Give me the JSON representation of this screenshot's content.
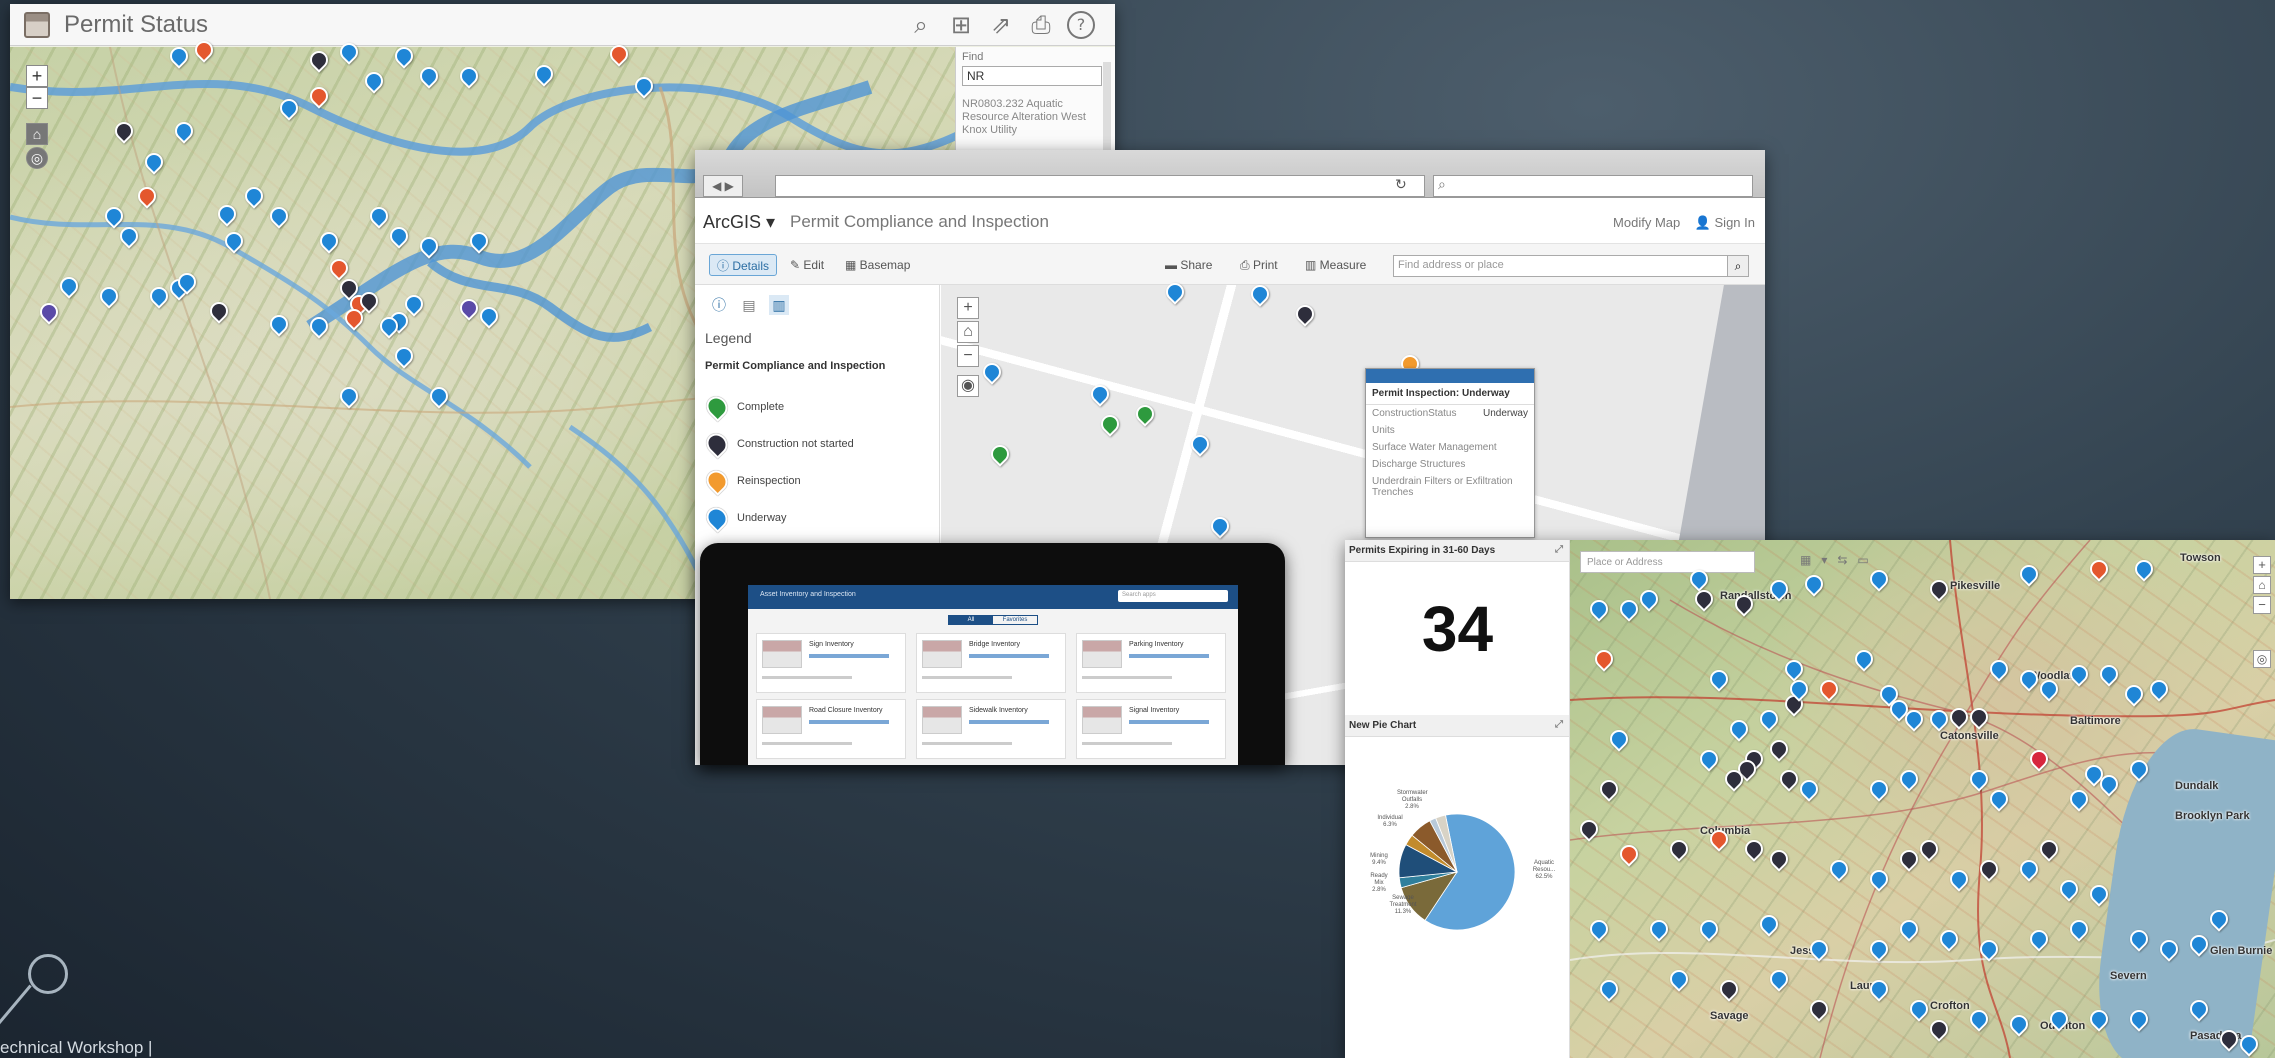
{
  "window1": {
    "title": "Permit Status",
    "tools": [
      {
        "name": "search-icon",
        "glyph": "⌕"
      },
      {
        "name": "basemap-gallery-icon",
        "glyph": "⊞"
      },
      {
        "name": "share-icon",
        "glyph": "⇗"
      },
      {
        "name": "print-icon",
        "glyph": "⎙"
      },
      {
        "name": "help-icon",
        "glyph": "?"
      }
    ],
    "zoom_in": "+",
    "zoom_out": "−",
    "find_label": "Find",
    "find_value": "NR",
    "find_result": "NR0803.232 Aquatic Resource Alteration West Knox Utility"
  },
  "window2": {
    "brand": "ArcGIS ▾",
    "app_title": "Permit Compliance and Inspection",
    "modify_map": "Modify Map",
    "sign_in": "Sign In",
    "toolbar": {
      "details": "Details",
      "edit": "Edit",
      "basemap": "Basemap",
      "share": "Share",
      "print": "Print",
      "measure": "Measure",
      "find_placeholder": "Find address or place"
    },
    "legend": {
      "heading": "Legend",
      "layer": "Permit Compliance and Inspection",
      "items": [
        {
          "label": "Complete",
          "color": "#2e9a3e"
        },
        {
          "label": "Construction not started",
          "color": "#2e2e3c"
        },
        {
          "label": "Reinspection",
          "color": "#f29a2e"
        },
        {
          "label": "Underway",
          "color": "#1f86d6"
        }
      ]
    },
    "popup": {
      "title": "Permit Inspection: Underway",
      "rows": [
        {
          "label": "ConstructionStatus",
          "value": "Underway"
        },
        {
          "label": "Units",
          "value": ""
        },
        {
          "label": "Surface Water Management",
          "value": ""
        },
        {
          "label": "Discharge Structures",
          "value": ""
        },
        {
          "label": "Underdrain Filters or Exfiltration Trenches",
          "value": ""
        }
      ]
    }
  },
  "tablet": {
    "app_title": "Asset Inventory and Inspection",
    "search_placeholder": "Search apps",
    "segments": [
      "All",
      "Favorites"
    ],
    "cards": [
      "Sign Inventory",
      "Bridge Inventory",
      "Parking Inventory",
      "Road Closure Inventory",
      "Sidewalk Inventory",
      "Signal Inventory"
    ]
  },
  "window3": {
    "counter_title": "Permits Expiring in 31-60 Days",
    "counter_value": "34",
    "pie_title": "New Pie Chart",
    "pie_labels": [
      {
        "text": "Stormwater Outfalls 2.8%"
      },
      {
        "text": "Individual 6.3%"
      },
      {
        "text": "Mining 9.4%"
      },
      {
        "text": "Ready Mix 2.8%"
      },
      {
        "text": "Sewage Treatment 11.3%"
      },
      {
        "text": "Aquatic Resou... 62.5%"
      }
    ],
    "search_placeholder": "Place or Address",
    "towns": [
      "Randallstown",
      "Pikesville",
      "Towson",
      "Woodlawn",
      "Baltimore",
      "Dundalk",
      "Catonsville",
      "Columbia",
      "Brooklyn Park",
      "Glen Burnie",
      "Severn",
      "Odenton",
      "Pasadena",
      "Crofton",
      "Laurel",
      "Savage",
      "Jessup"
    ]
  },
  "chart_data": {
    "type": "pie",
    "title": "New Pie Chart",
    "slices": [
      {
        "label": "Aquatic Resou...",
        "value": 62.5,
        "color": "#5fa3d9"
      },
      {
        "label": "Sewage Treatment",
        "value": 11.3,
        "color": "#7a6a3a"
      },
      {
        "label": "Ready Mix",
        "value": 2.8,
        "color": "#2f7f9c"
      },
      {
        "label": "Mining",
        "value": 9.4,
        "color": "#1f4e79"
      },
      {
        "label": "",
        "value": 3.1,
        "color": "#c28b2c"
      },
      {
        "label": "Individual",
        "value": 6.3,
        "color": "#8b5a2b"
      },
      {
        "label": "",
        "value": 1.8,
        "color": "#b8c9d9"
      },
      {
        "label": "Stormwater Outfalls",
        "value": 2.8,
        "color": "#d8d3c6"
      }
    ]
  },
  "footer": "echnical Workshop |"
}
